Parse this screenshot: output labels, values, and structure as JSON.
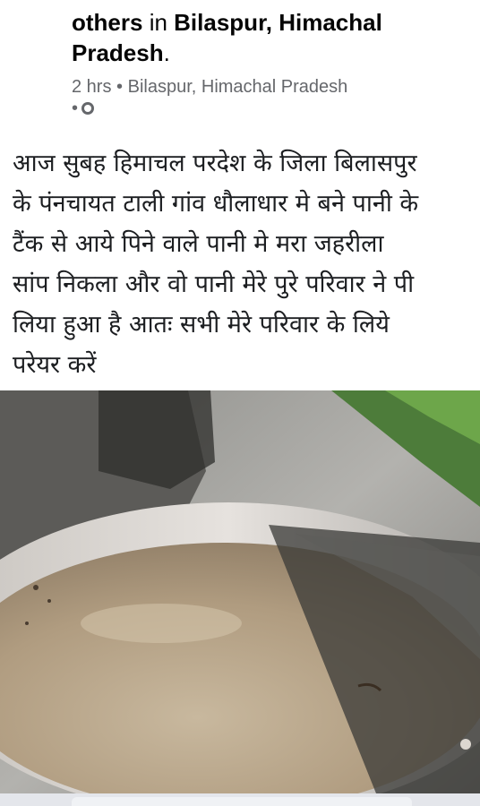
{
  "post": {
    "title_bold_1": "others",
    "title_in": " in ",
    "title_bold_2": "Bilaspur, Himachal Pradesh",
    "title_period": ".",
    "time": "2 hrs",
    "separator": "•",
    "location": "Bilaspur, Himachal Pradesh",
    "separator2": "•",
    "audience_icon": "globe-icon",
    "text_lines": [
      "आज सुबह हिमाचल परदेश के जिला बिलासपुर",
      "के पंनचायत टाली गांव धौलाधार मे बने पानी के",
      "टैंक से आये पिने वाले पानी मे मरा जहरीला",
      "सांप निकला और वो पानी मेरे पुरे परिवार ने पी",
      "लिया हुआ है  आतः सभी मेरे परिवार के लिये",
      "परेयर करें"
    ]
  },
  "colors": {
    "text_primary": "#050505",
    "text_secondary": "#65676b",
    "water": "#b8a48a",
    "pot_rim": "#d9d4d0",
    "concrete": "#a7a6a2",
    "grass": "#3f7a2a"
  }
}
